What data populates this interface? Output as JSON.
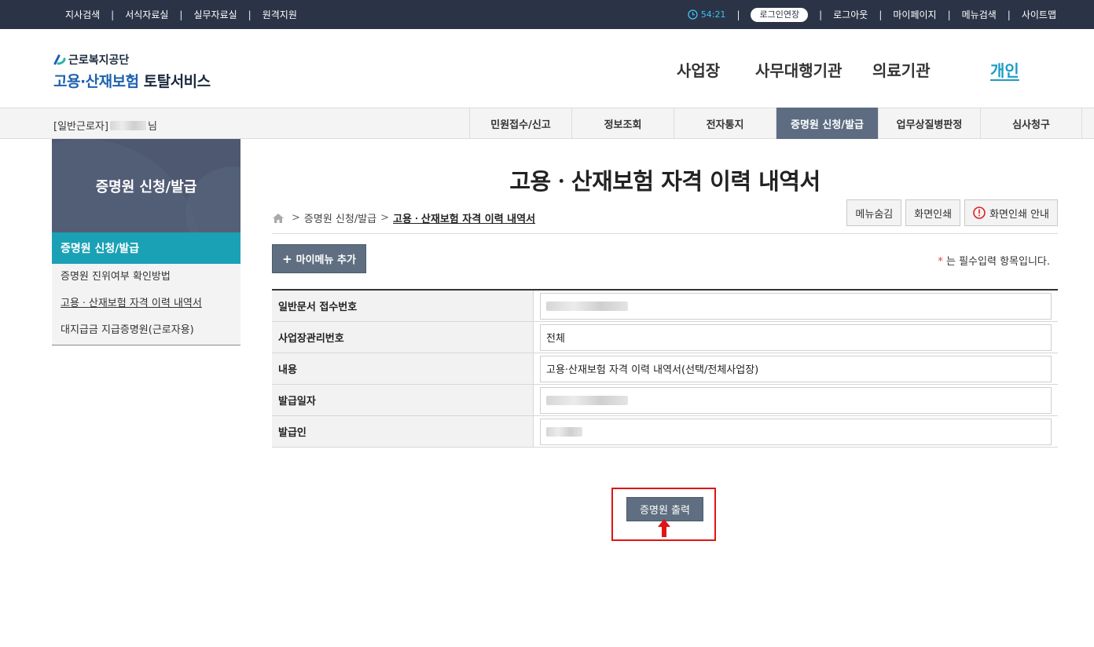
{
  "topbar": {
    "left_links": [
      "지사검색",
      "서식자료실",
      "실무자료실",
      "원격지원"
    ],
    "timer": "54:21",
    "extend_label": "로그인연장",
    "right_links": [
      "로그아웃",
      "마이페이지",
      "메뉴검색",
      "사이트맵"
    ],
    "separator": "|"
  },
  "header": {
    "org_name": "근로복지공단",
    "service_blue": "고용·산재보험",
    "service_dark": "토탈서비스",
    "gnb": [
      "사업장",
      "사무대행기관",
      "의료기관",
      "개인"
    ],
    "gnb_active": "개인"
  },
  "subnav": {
    "user_prefix": "[일반근로자]",
    "user_suffix": "님",
    "tabs": [
      "민원접수/신고",
      "정보조회",
      "전자통지",
      "증명원 신청/발급",
      "업무상질병판정",
      "심사청구"
    ],
    "active_tab": "증명원 신청/발급"
  },
  "sidebar": {
    "title": "증명원 신청/발급",
    "active_section": "증명원 신청/발급",
    "items": [
      "증명원 진위여부 확인방법",
      "고용ㆍ산재보험 자격 이력 내역서",
      "대지급금 지급증명원(근로자용)"
    ],
    "current_item": "고용ㆍ산재보험 자격 이력 내역서"
  },
  "main": {
    "title": "고용ㆍ산재보험 자격 이력 내역서",
    "breadcrumb": [
      "증명원 신청/발급",
      "고용ㆍ산재보험 자격 이력 내역서"
    ],
    "util_buttons": {
      "hide_menu": "메뉴숨김",
      "print_screen": "화면인쇄",
      "print_guide": "화면인쇄 안내"
    },
    "mymenu_add": "마이메뉴 추가",
    "required_note_star": "*",
    "required_note": "는 필수입력 항목입니다.",
    "form": [
      {
        "label": "일반문서 접수번호",
        "value": ""
      },
      {
        "label": "사업장관리번호",
        "value": "전체"
      },
      {
        "label": "내용",
        "value": "고용·산재보험 자격 이력 내역서(선택/전체사업장)"
      },
      {
        "label": "발급일자",
        "value": ""
      },
      {
        "label": "발급인",
        "value": ""
      }
    ],
    "print_button": "증명원 출력"
  },
  "colors": {
    "topbar_bg": "#2b3447",
    "accent_teal": "#1aa1b5",
    "active_tab_bg": "#5d6c80",
    "highlight_red": "#e01414"
  }
}
